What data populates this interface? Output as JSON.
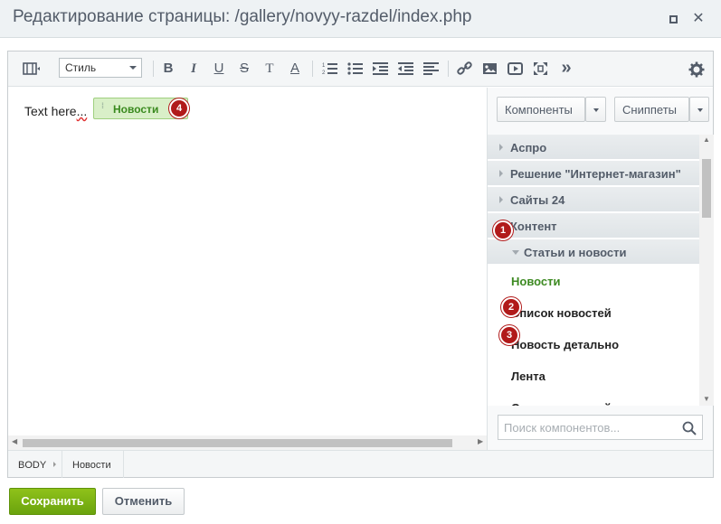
{
  "window": {
    "title": "Редактирование страницы: /gallery/novyy-razdel/index.php"
  },
  "toolbar": {
    "style_select_value": "Стиль",
    "icons": [
      "source-mode-icon",
      "bold-icon",
      "italic-icon",
      "underline-icon",
      "strikethrough-icon",
      "remove-format-icon",
      "text-color-icon",
      "numbered-list-icon",
      "bullet-list-icon",
      "indent-icon",
      "outdent-icon",
      "align-icon",
      "link-icon",
      "image-icon",
      "video-icon",
      "fullscreen-icon",
      "more-icon",
      "settings-icon"
    ],
    "bold": "B",
    "italic": "I",
    "underline": "U",
    "strike": "S",
    "clear": "T",
    "color": "A",
    "more": "»"
  },
  "content": {
    "text_before": "Text here",
    "text_dots": "...",
    "component_chip": "Новости"
  },
  "panel": {
    "components_label": "Компоненты",
    "snippets_label": "Сниппеты",
    "groups": [
      {
        "label": "Аспро"
      },
      {
        "label": "Решение \"Интернет-магазин\""
      },
      {
        "label": "Сайты 24"
      },
      {
        "label": "Контент"
      },
      {
        "label": "Статьи и новости"
      }
    ],
    "items": [
      {
        "label": "Новости"
      },
      {
        "label": "Список новостей"
      },
      {
        "label": "Новость детально"
      },
      {
        "label": "Лента"
      },
      {
        "label": "Список новостей для ленты"
      }
    ],
    "search_placeholder": "Поиск компонентов..."
  },
  "statusbar": {
    "crumbs": [
      "BODY",
      "Новости"
    ]
  },
  "badges": [
    "1",
    "2",
    "3",
    "4"
  ],
  "buttons": {
    "save": "Сохранить",
    "cancel": "Отменить"
  },
  "colors": {
    "accent_green": "#6aa30d",
    "badge_red": "#b11a1a",
    "active_item": "#3d8a22"
  }
}
